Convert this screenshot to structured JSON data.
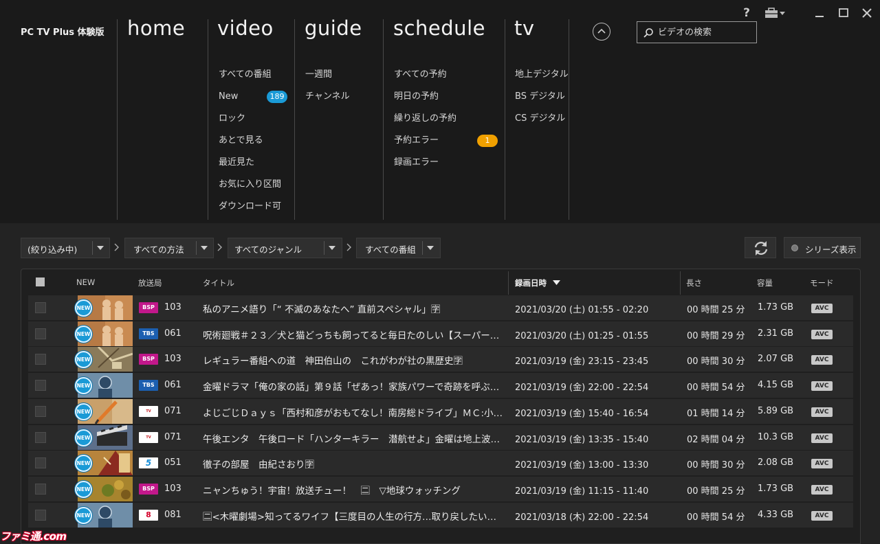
{
  "app": {
    "title": "PC TV Plus 体験版"
  },
  "nav": {
    "home": {
      "title": "home",
      "items": []
    },
    "video": {
      "title": "video",
      "items": [
        {
          "label": "すべての番組"
        },
        {
          "label": "New",
          "badge": "189"
        },
        {
          "label": "ロック"
        },
        {
          "label": "あとで見る"
        },
        {
          "label": "最近見た"
        },
        {
          "label": "お気に入り区間"
        },
        {
          "label": "ダウンロード可"
        }
      ]
    },
    "guide": {
      "title": "guide",
      "items": [
        {
          "label": "一週間"
        },
        {
          "label": "チャンネル"
        }
      ]
    },
    "schedule": {
      "title": "schedule",
      "items": [
        {
          "label": "すべての予約"
        },
        {
          "label": "明日の予約"
        },
        {
          "label": "繰り返しの予約"
        },
        {
          "label": "予約エラー",
          "badge": "1"
        },
        {
          "label": "録画エラー"
        }
      ]
    },
    "tv": {
      "title": "tv",
      "items": [
        {
          "label": "地上デジタル"
        },
        {
          "label": "BS デジタル"
        },
        {
          "label": "CS デジタル"
        }
      ]
    }
  },
  "search": {
    "placeholder": "ビデオの検索"
  },
  "window": {
    "help": "?"
  },
  "filters": {
    "narrow": "(絞り込み中)",
    "method": "すべての方法",
    "genre": "すべてのジャンル",
    "programs": "すべての番組",
    "series_toggle": "シリーズ表示"
  },
  "table": {
    "headers": {
      "new": "NEW",
      "station": "放送局",
      "title": "タイトル",
      "recorded": "録画日時",
      "length": "長さ",
      "size": "容量",
      "mode": "モード"
    },
    "rows": [
      {
        "new": "NEW",
        "channel_logo": "BSP",
        "channel_logo_color": "#c2188b",
        "channel": "103",
        "title": "私のアニメ語り「“ 不滅のあなたへ” 直前スペシャル」🈑",
        "date": "2021/03/20 (土) 01:55 - 02:20",
        "length": "00 時間 25 分",
        "size": "1.73 GB",
        "mode": "AVC",
        "thumb": "orange-people"
      },
      {
        "new": "NEW",
        "channel_logo": "TBS",
        "channel_logo_color": "#1c5fb0",
        "channel": "061",
        "title": "呪術廻戦＃２３／犬と猫どっちも飼ってると毎日たのしい【スーパー…",
        "date": "2021/03/20 (土) 01:25 - 01:55",
        "length": "00 時間 29 分",
        "size": "2.31 GB",
        "mode": "AVC",
        "thumb": "orange-people"
      },
      {
        "new": "NEW",
        "channel_logo": "BSP",
        "channel_logo_color": "#c2188b",
        "channel": "103",
        "title": "レギュラー番組への道　神田伯山の　これがわが社の黒歴史🈑",
        "date": "2021/03/19 (金) 23:15 - 23:45",
        "length": "00 時間 30 分",
        "size": "2.07 GB",
        "mode": "AVC",
        "thumb": "map"
      },
      {
        "new": "NEW",
        "channel_logo": "TBS",
        "channel_logo_color": "#1c5fb0",
        "channel": "061",
        "title": "金曜ドラマ「俺の家の話」第９話「ぜあっ！家族パワーで奇跡を呼ぶ…",
        "date": "2021/03/19 (金) 22:00 - 22:54",
        "length": "00 時間 54 分",
        "size": "4.15 GB",
        "mode": "AVC",
        "thumb": "blue-person"
      },
      {
        "new": "NEW",
        "channel_logo": "TV TOKYO",
        "channel_logo_color": "#ffffff",
        "channel": "071",
        "title": "よじごじＤａｙｓ「西村和彦がおもてなし！南房総ドライブ」ＭＣ:小…",
        "date": "2021/03/19 (金) 15:40 - 16:54",
        "length": "01 時間 14 分",
        "size": "5.89 GB",
        "mode": "AVC",
        "thumb": "pencil"
      },
      {
        "new": "NEW",
        "channel_logo": "TV TOKYO",
        "channel_logo_color": "#ffffff",
        "channel": "071",
        "title": "午後エンタ　午後ロード「ハンターキラー　潜航せよ」金曜は地上波…",
        "date": "2021/03/19 (金) 13:35 - 15:40",
        "length": "02 時間 04 分",
        "size": "10.3 GB",
        "mode": "AVC",
        "thumb": "clapper"
      },
      {
        "new": "NEW",
        "channel_logo": "5",
        "channel_logo_color": "#ffffff",
        "channel": "051",
        "title": "徹子の部屋　由紀さおり🈑",
        "date": "2021/03/19 (金) 13:00 - 13:30",
        "length": "00 時間 30 分",
        "size": "2.08 GB",
        "mode": "AVC",
        "thumb": "theater"
      },
      {
        "new": "NEW",
        "channel_logo": "BSP",
        "channel_logo_color": "#c2188b",
        "channel": "103",
        "title": "ニャンちゅう！宇宙！放送チュー！　🈔　▽地球ウォッチング",
        "date": "2021/03/19 (金) 11:15 - 11:40",
        "length": "00 時間 25 分",
        "size": "1.73 GB",
        "mode": "AVC",
        "thumb": "leaves"
      },
      {
        "new": "NEW",
        "channel_logo": "8",
        "channel_logo_color": "#ffffff",
        "channel": "081",
        "title": "🈔<木曜劇場>知ってるワイフ【三度目の人生の行方…取り戻したい…",
        "date": "2021/03/18 (木) 22:00 - 22:54",
        "length": "00 時間 54 分",
        "size": "4.33 GB",
        "mode": "AVC",
        "thumb": "blue-person"
      }
    ]
  },
  "watermark": "ファミ通.com"
}
